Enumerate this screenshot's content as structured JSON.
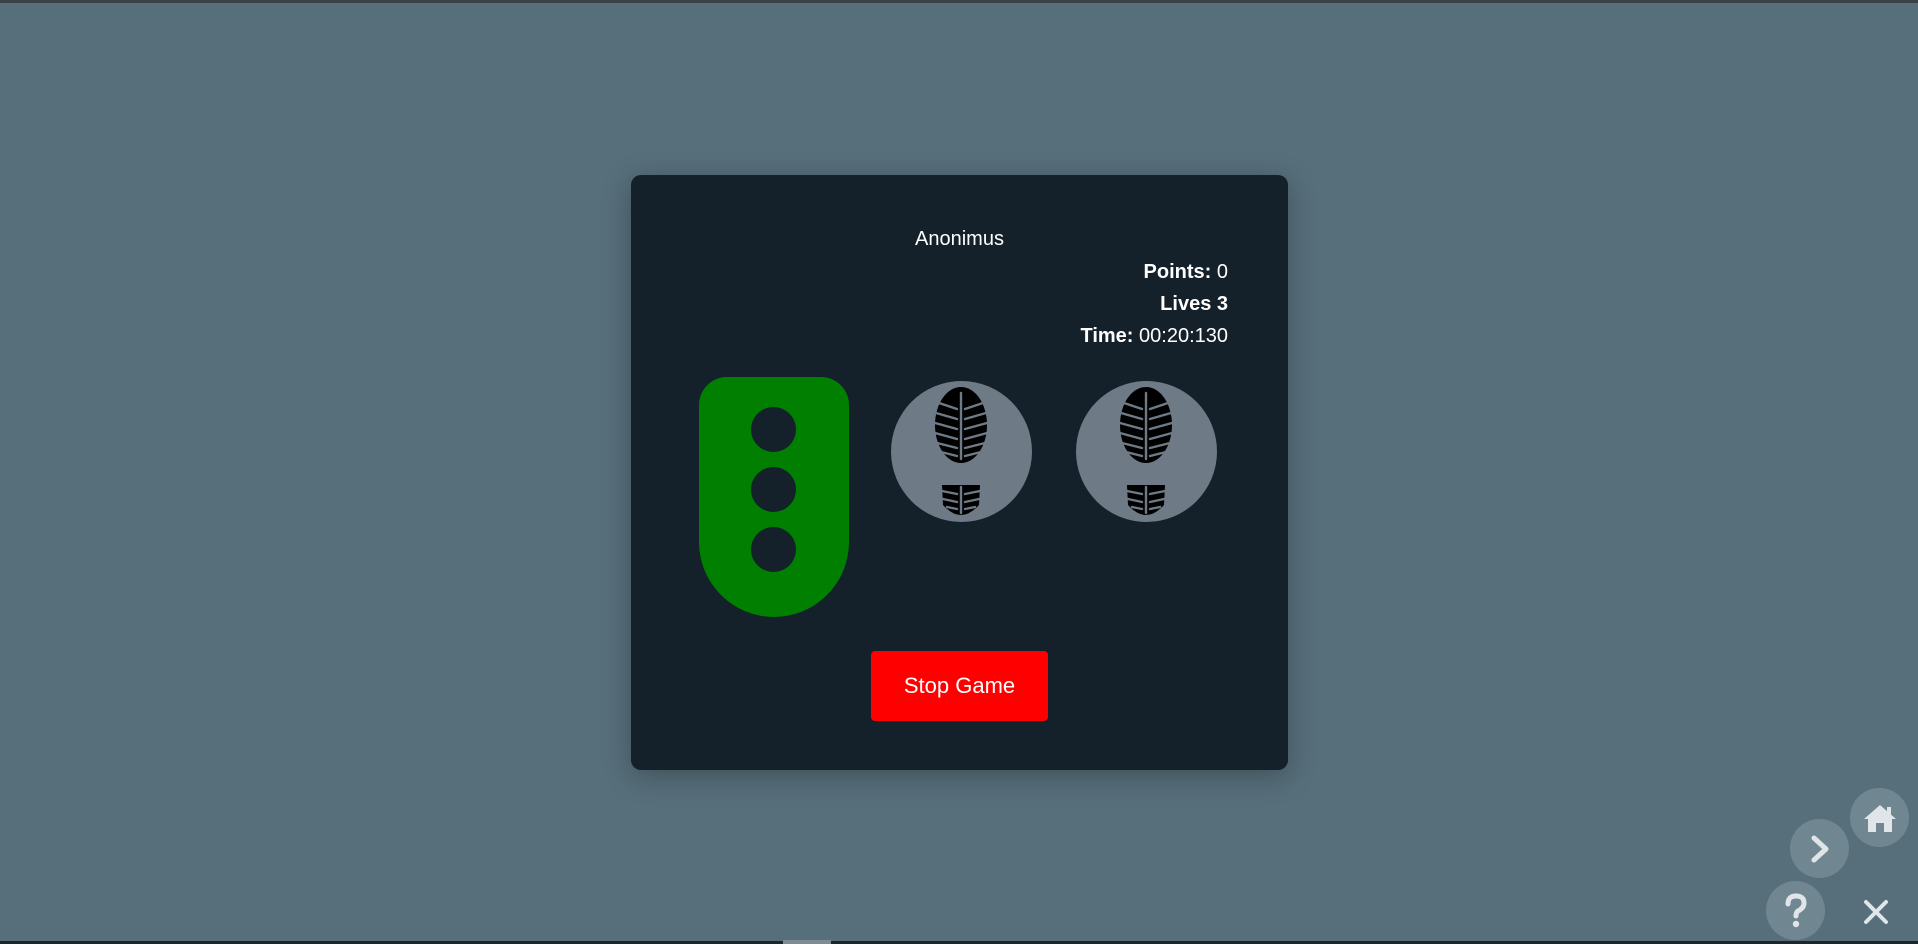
{
  "player": {
    "name": "Anonimus"
  },
  "stats": {
    "points_label": "Points:",
    "points_value": "0",
    "lives_label": "Lives 3",
    "time_label": "Time:",
    "time_value": "00:20:130"
  },
  "traffic_light": {
    "state": "green",
    "color": "#017f01",
    "lamps": 3
  },
  "step_buttons": [
    {
      "name": "left-foot",
      "icon": "footprint-icon"
    },
    {
      "name": "right-foot",
      "icon": "footprint-icon"
    }
  ],
  "controls": {
    "stop_label": "Stop Game",
    "stop_color": "#ff0000"
  },
  "floating_nav": {
    "home_icon": "home-icon",
    "next_icon": "chevron-right-icon",
    "help_icon": "question-icon",
    "close_icon": "close-icon"
  },
  "colors": {
    "background": "#576f7b",
    "panel": "#14212b",
    "step_button": "#6e7b86",
    "fab": "#708791"
  }
}
